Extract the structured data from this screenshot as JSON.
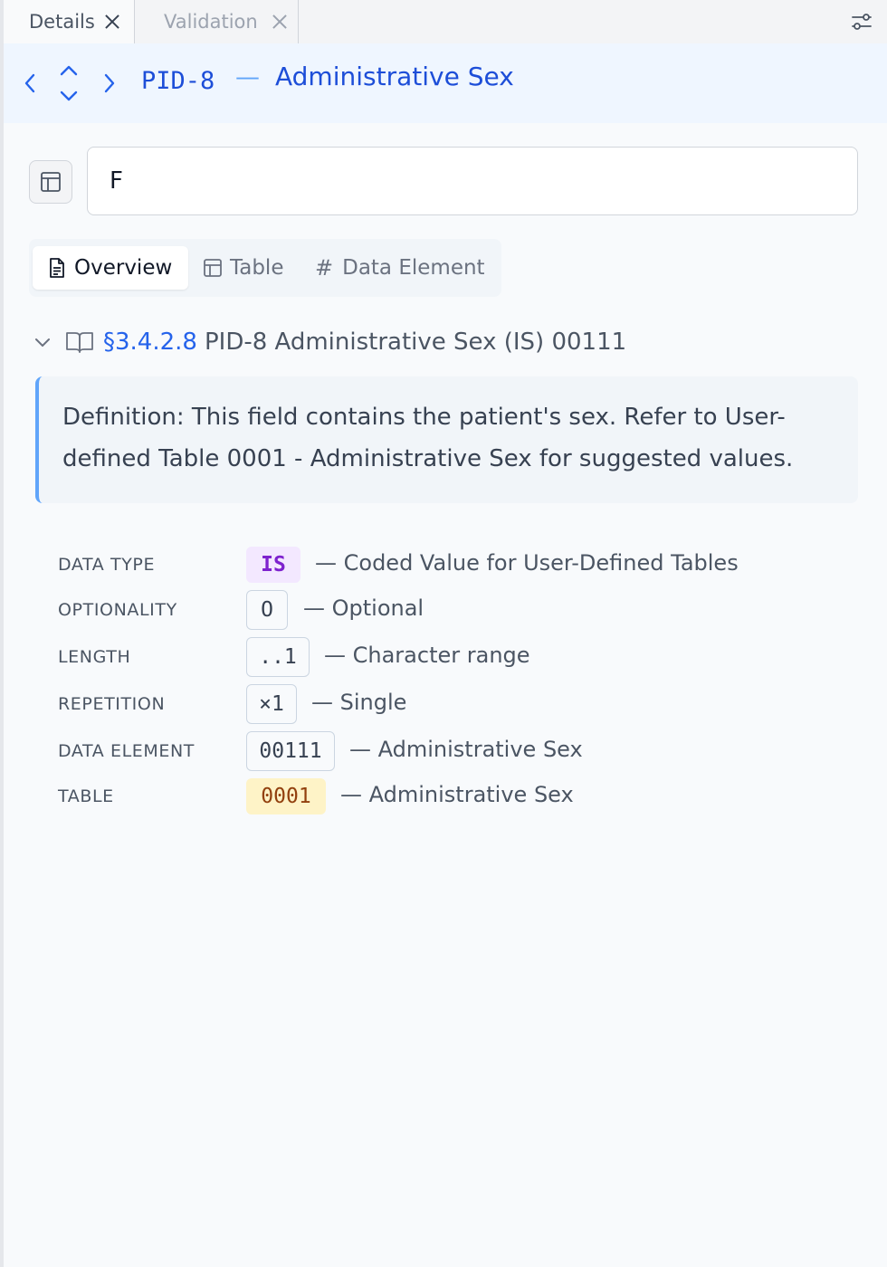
{
  "tabs": [
    {
      "label": "Details"
    },
    {
      "label": "Validation"
    }
  ],
  "header": {
    "code": "PID-8",
    "separator": "—",
    "name": "Administrative Sex"
  },
  "value_input": {
    "value": "F"
  },
  "view_tabs": {
    "overview": "Overview",
    "table": "Table",
    "data_element": "Data Element",
    "active": "Overview"
  },
  "section": {
    "ref": "§3.4.2.8",
    "title": "PID-8 Administrative Sex (IS) 00111"
  },
  "definition": "Definition: This field contains the patient's sex. Refer to User-defined Table 0001 - Administrative Sex for suggested values.",
  "properties": {
    "data_type": {
      "label": "DATA TYPE",
      "value": "IS",
      "desc": "— Coded Value for User-Defined Tables"
    },
    "optionality": {
      "label": "OPTIONALITY",
      "value": "O",
      "desc": "— Optional"
    },
    "length": {
      "label": "LENGTH",
      "value": "..1",
      "desc": "— Character range"
    },
    "repetition": {
      "label": "REPETITION",
      "value": "×1",
      "desc": "— Single"
    },
    "data_element": {
      "label": "DATA ELEMENT",
      "value": "00111",
      "desc": "— Administrative Sex"
    },
    "table": {
      "label": "TABLE",
      "value": "0001",
      "desc": "— Administrative Sex"
    }
  },
  "colors": {
    "accent": "#1d4ed8",
    "header_bg": "#eff6ff",
    "type_chip_bg": "#f3e8ff",
    "table_chip_bg": "#fef3c7"
  }
}
